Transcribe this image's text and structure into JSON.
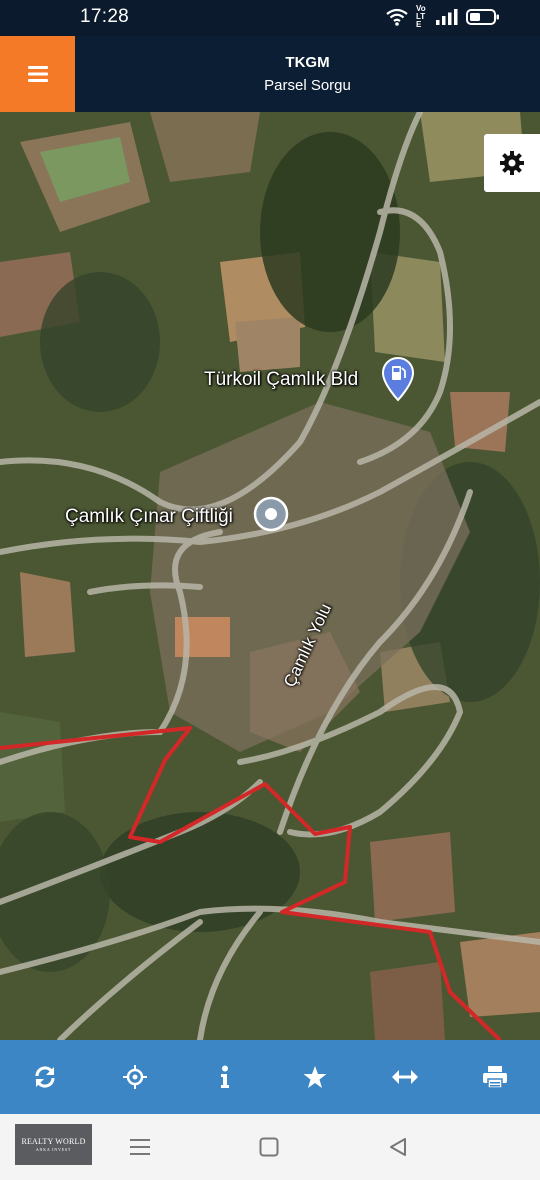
{
  "status_bar": {
    "time": "17:28",
    "icons": [
      "wifi-icon",
      "volte-icon",
      "signal-icon",
      "battery-icon"
    ],
    "volte_text": "Vo LTE"
  },
  "header": {
    "title": "TKGM",
    "subtitle": "Parsel Sorgu",
    "menu_icon": "hamburger-icon",
    "accent_color": "#f47a28",
    "background_color": "#0c1e33"
  },
  "map": {
    "view": "satellite",
    "labels": {
      "fuel_station": "Türkoil Çamlık Bld",
      "farm": "Çamlık Çınar Çiftliği",
      "road": "Çamlık Yolu"
    },
    "markers": [
      "fuel-station-marker",
      "place-marker"
    ],
    "parcel_boundary_color": "#d42727",
    "settings_icon": "gear-icon"
  },
  "toolbar": {
    "background_color": "#3d86c6",
    "buttons": [
      "refresh-icon",
      "locate-icon",
      "info-icon",
      "star-icon",
      "measure-icon",
      "print-icon"
    ]
  },
  "nav_bar": {
    "ad_text_line1": "REALTY WORLD",
    "ad_text_line2": "ANKA INVEST",
    "keys": [
      "recent-apps-icon",
      "home-icon",
      "back-icon"
    ]
  }
}
